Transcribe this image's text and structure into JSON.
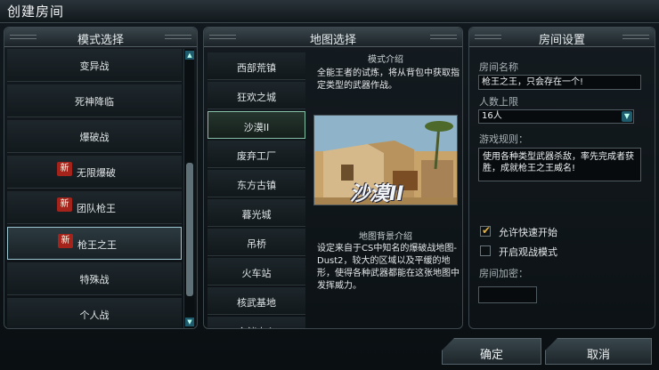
{
  "window": {
    "title": "创建房间"
  },
  "mode_panel": {
    "header": "模式选择",
    "items": [
      {
        "label": "变异战",
        "new": ""
      },
      {
        "label": "死神降临",
        "new": ""
      },
      {
        "label": "爆破战",
        "new": ""
      },
      {
        "label": "无限爆破",
        "new": "新"
      },
      {
        "label": "团队枪王",
        "new": "新"
      },
      {
        "label": "枪王之王",
        "new": "新"
      },
      {
        "label": "特殊战",
        "new": ""
      },
      {
        "label": "个人战",
        "new": ""
      }
    ],
    "selected_index": 5
  },
  "map_panel": {
    "header": "地图选择",
    "maps": [
      "西部荒镇",
      "狂欢之城",
      "沙漠II",
      "废弃工厂",
      "东方古镇",
      "暮光城",
      "吊桥",
      "火车站",
      "核武基地",
      "仓储中心"
    ],
    "selected_index": 2,
    "mode_intro_title": "模式介绍",
    "mode_intro_text": "全能王者的试炼，将从背包中获取指定类型的武器作战。",
    "preview_caption": "沙漠II",
    "map_bg_title": "地图背景介绍",
    "map_bg_text": "设定来自于CS中知名的爆破战地图-Dust2，较大的区域以及平缓的地形，使得各种武器都能在这张地图中发挥威力。"
  },
  "settings_panel": {
    "header": "房间设置",
    "room_name_label": "房间名称",
    "room_name_value": "枪王之王，只会存在一个!",
    "max_players_label": "人数上限",
    "max_players_value": "16人",
    "rules_label": "游戏规则：",
    "rules_text": "使用各种类型武器杀敌，率先完成者获胜，成就枪王之王威名!",
    "quick_start_label": "允许快速开始",
    "quick_start_checked": true,
    "spectator_label": "开启观战模式",
    "spectator_checked": false,
    "password_label": "房间加密："
  },
  "buttons": {
    "ok": "确定",
    "cancel": "取消"
  },
  "colors": {
    "accent": "#9cc7d2",
    "badge": "#a4231b",
    "check": "#e6b33a"
  }
}
